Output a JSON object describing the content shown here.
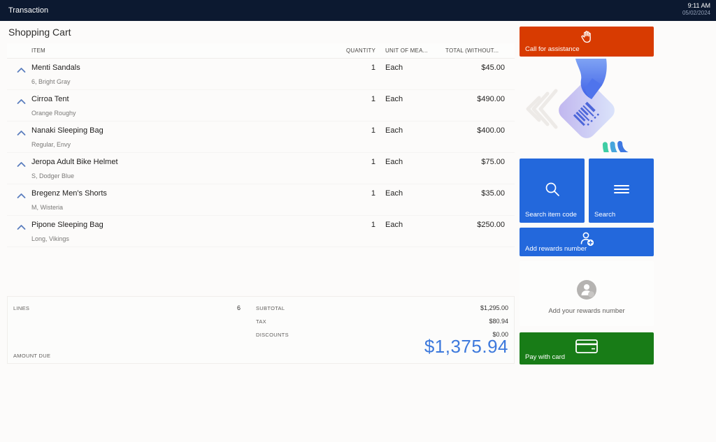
{
  "topbar": {
    "title": "Transaction",
    "time": "9:11 AM",
    "date": "05/02/2024"
  },
  "cart": {
    "title": "Shopping Cart",
    "columns": {
      "item": "ITEM",
      "quantity": "QUANTITY",
      "unit": "UNIT OF MEA...",
      "total": "TOTAL (WITHOUT..."
    },
    "items": [
      {
        "name": "Menti Sandals",
        "variant": "6, Bright Gray",
        "quantity": "1",
        "unit": "Each",
        "total": "$45.00"
      },
      {
        "name": "Cirroa Tent",
        "variant": "Orange Roughy",
        "quantity": "1",
        "unit": "Each",
        "total": "$490.00"
      },
      {
        "name": "Nanaki Sleeping Bag",
        "variant": "Regular, Envy",
        "quantity": "1",
        "unit": "Each",
        "total": "$400.00"
      },
      {
        "name": "Jeropa Adult Bike Helmet",
        "variant": "S, Dodger Blue",
        "quantity": "1",
        "unit": "Each",
        "total": "$75.00"
      },
      {
        "name": "Bregenz Men's Shorts",
        "variant": "M, Wisteria",
        "quantity": "1",
        "unit": "Each",
        "total": "$35.00"
      },
      {
        "name": "Pipone Sleeping Bag",
        "variant": "Long, Vikings",
        "quantity": "1",
        "unit": "Each",
        "total": "$250.00"
      }
    ]
  },
  "summary": {
    "lines_label": "LINES",
    "lines_value": "6",
    "subtotal_label": "SUBTOTAL",
    "subtotal_value": "$1,295.00",
    "tax_label": "TAX",
    "tax_value": "$80.94",
    "discounts_label": "DISCOUNTS",
    "discounts_value": "$0.00",
    "amount_due_label": "AMOUNT DUE",
    "amount_due_value": "$1,375.94"
  },
  "actions": {
    "call_assistance": "Call for assistance",
    "search_item_code": "Search item code",
    "search": "Search",
    "add_rewards": "Add rewards number",
    "add_your_rewards": "Add your rewards number",
    "pay_with_card": "Pay with card"
  },
  "colors": {
    "topbar": "#0C1930",
    "accent_orange": "#D83B01",
    "accent_blue": "#2368DC",
    "accent_green": "#187C17",
    "amount_blue": "#3D79DC"
  }
}
